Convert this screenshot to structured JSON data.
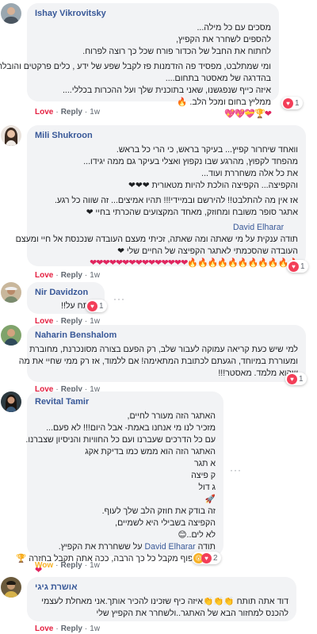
{
  "comments": [
    {
      "author": "Ishay Vikrovitsky",
      "lines": [
        "מסכים עם כל מילה...",
        "להספים לשחרר את הקפיץ,",
        "לחתוח את החבל של הכדור פורח שכל כך רוצה לפרוח.",
        "",
        "ומי שמתלבט, מפסיד פה הזדמנות פז לקבל שפע של ידע , כלים פרקטים והובלה",
        "בהדרגה של מאסטר בתחום....",
        "איזה כייף שנפגשנו, שאני בתוכנית שלך ועל ההכרות בכללי....",
        "ממליץ בחום ומכל הלב."
      ],
      "emoji_line": "❤🏆💝💖💖",
      "react": "Love",
      "reply": "Reply",
      "time": "1w",
      "count": "1"
    },
    {
      "author": "Mili Shukroon",
      "lines": [
        "וואחד שיחרור קפיץ... בעיקר בראש, כי הרי כל בראש.",
        "מהפחד לקפוץ, מהרגע שבו נקפוץ ואצלי בעיקר גם ממה יגידו...",
        "את כל אלה משחררת ועוד...",
        "והקפיצה... הקפיצה הולכת להיות מטאורית ❤❤❤",
        "",
        "אז אין מה להתלבט!! להירשם ובמיידי!!! תהיו אמיצים... זה שווה כל רגע.",
        "אתגר סופר משובח ומחוזק, מאחד המקצועים שהכרתי בחיי ❤"
      ],
      "mention": "David Elharar",
      "mention_lines": [
        "תודה ענקית על מי שאתה ומה שאתה, זכיתי מעצם העובדה שנכנסת אל חיי ומעצם",
        "העובדה שהסכמתי לאתגר הקפיצה של החיים שלי ❤"
      ],
      "emoji_line": "🔥🔥🔥🔥🔥🔥🔥🔥🔥🔥🔥❤❤❤❤❤❤❤❤❤❤❤❤❤❤❤",
      "react": "Love",
      "reply": "Reply",
      "time": "1w",
      "count": "1"
    },
    {
      "author": "Nir Davidzon",
      "lines": [
        "תותח על!!"
      ],
      "react": "Love",
      "reply": "Reply",
      "time": "1w",
      "count": "1"
    },
    {
      "author": "Naharin Benshalom",
      "lines": [
        "למי שיש כעת קריאה עמוקה לעבור שלב, רק הפעם בצורה מסונכרנת, מחוברת",
        "ומעוררת במיוחד, הגעתם לכתובת המתאימה! אם ללמוד, אז רק ממי שחיי את מה",
        "שהוא מלמד. מאסטר!!!"
      ],
      "react": "Love",
      "reply": "Reply",
      "time": "1w",
      "count": "1"
    },
    {
      "author": "Revital Tamir",
      "lines": [
        "האתגר הזה מעורר לחיים,",
        "מזכיר לנו מי אנחנו באמת- אבל היום!!! לא פעם...",
        "עם כל הדרכים שעברנו ועם כל החוויות והניסיון שצברנו.",
        "האתגר הזה הוא ממש כמו בדיקת אקג",
        "א תגר",
        "ק פיצה",
        "ג דול",
        "🚀",
        "זה בודק את חוזק הלב שלך לעוף.",
        "הקפיצה בשבילי היא לשמיים,",
        "לא לים..😊"
      ],
      "mention": "David Elharar",
      "mention_prefix": "תודה",
      "mention_suffix": "על ששחררת את הקפיץ.",
      "last_line": "כשהקיפוף מקבל כל כך הרבה, ככה אתה תקבל בחזרה 🏆",
      "emoji_line": "❤",
      "react": "Wow",
      "reply": "Reply",
      "time": "1w",
      "count": "2"
    },
    {
      "author": "אושרת גיגי",
      "lines": [
        "דוד אתה תותח 👏👏👏איזה כיף שזכינו להכיר אותך.אני מאחלת לעצמי",
        "להכנס למחזור הבא של האתגר..ולשחרר את הקפיץ שלי"
      ],
      "react": "Love",
      "reply": "Reply",
      "time": "1w"
    }
  ],
  "more_icon": "ellipsis-icon",
  "colors": {
    "author": "#385898",
    "love": "#e41e3f",
    "wow": "#f7b125",
    "bubble": "#f2f3f5"
  }
}
